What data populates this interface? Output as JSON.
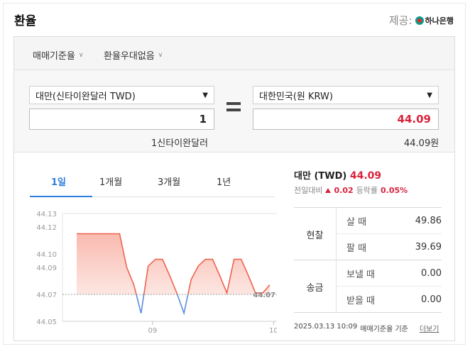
{
  "header": {
    "title": "환율",
    "provider_prefix": "제공:",
    "provider_name": "하나은행"
  },
  "options": [
    {
      "label": "매매기준율"
    },
    {
      "label": "환율우대없음"
    }
  ],
  "converter": {
    "from_currency": "대만(신타이완달러 TWD)",
    "to_currency": "대한민국(원 KRW)",
    "from_amount": "1",
    "to_amount": "44.09",
    "from_unit_text": "1신타이완달러",
    "to_unit_text": "44.09원"
  },
  "tabs": [
    {
      "label": "1일",
      "active": true
    },
    {
      "label": "1개월",
      "active": false
    },
    {
      "label": "3개월",
      "active": false
    },
    {
      "label": "1년",
      "active": false
    }
  ],
  "chart_data": {
    "type": "line",
    "y_ticks": [
      "44.13",
      "44.12",
      "44.10",
      "44.09",
      "44.07",
      "44.05"
    ],
    "x_ticks": [
      "09",
      "10"
    ],
    "ylim": [
      44.05,
      44.13
    ],
    "baseline": 44.07,
    "baseline_label": "44.07",
    "series": [
      {
        "values": [
          44.115,
          44.115,
          44.115,
          44.115,
          44.115,
          44.115,
          44.115,
          44.09,
          44.077,
          44.056,
          44.091,
          44.096,
          44.096,
          44.084,
          44.071,
          44.056,
          44.081,
          44.091,
          44.096,
          44.096,
          44.084,
          44.071,
          44.096,
          44.096,
          44.084,
          44.071,
          44.071,
          44.077
        ]
      }
    ],
    "colors": {
      "up_line": "#f0624d",
      "down_line": "#5a8ee0",
      "up_fill": "#f8b3a7",
      "baseline": "#999999"
    }
  },
  "summary": {
    "name": "대만 (TWD)",
    "value": "44.09",
    "change_label": "전일대비",
    "change_value": "0.02",
    "rate_label": "등락률",
    "rate_value": "0.05%"
  },
  "rates": {
    "cash": {
      "group": "현찰",
      "buy_label": "살 때",
      "buy": "49.86",
      "sell_label": "팔 때",
      "sell": "39.69"
    },
    "remit": {
      "group": "송금",
      "send_label": "보낼 때",
      "send": "0.00",
      "recv_label": "받을 때",
      "recv": "0.00"
    }
  },
  "footer": {
    "timestamp": "2025.03.13 10:09",
    "basis": "매매기준율 기준",
    "more": "더보기"
  }
}
